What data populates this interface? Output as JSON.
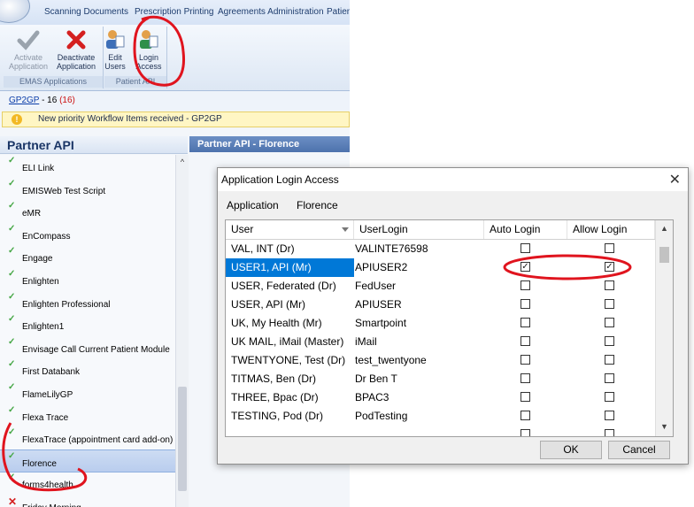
{
  "menubar": {
    "tabs": [
      "Scanning Documents",
      "Prescription Printing",
      "Agreements Administration",
      "Patien"
    ]
  },
  "ribbon": {
    "groups": [
      {
        "label": "EMAS Applications",
        "buttons": [
          {
            "label": "Activate Application",
            "icon": "check-icon",
            "enabled": false
          },
          {
            "label": "Deactivate Application",
            "icon": "red-x-icon",
            "enabled": true
          }
        ]
      },
      {
        "label": "Patient API",
        "buttons": [
          {
            "label": "Edit Users",
            "icon": "users-icon",
            "enabled": true
          },
          {
            "label": "Login Access",
            "icon": "user-key-icon",
            "enabled": true
          }
        ]
      }
    ]
  },
  "gp2gp": {
    "link": "GP2GP",
    "count": "- 16",
    "count_red": "(16)"
  },
  "notice": {
    "text": "New priority Workflow Items received - GP2GP",
    "icon": "warning-icon"
  },
  "partner_panel": {
    "title": "Partner API"
  },
  "detail_panel": {
    "title": "Partner API - Florence"
  },
  "app_list": [
    {
      "name": "ELI Link",
      "status": "tick"
    },
    {
      "name": "EMISWeb Test Script",
      "status": "tick"
    },
    {
      "name": "eMR",
      "status": "tick"
    },
    {
      "name": "EnCompass",
      "status": "tick"
    },
    {
      "name": "Engage",
      "status": "tick"
    },
    {
      "name": "Enlighten",
      "status": "tick"
    },
    {
      "name": "Enlighten Professional",
      "status": "tick"
    },
    {
      "name": "Enlighten1",
      "status": "tick"
    },
    {
      "name": "Envisage Call Current Patient Module",
      "status": "tick"
    },
    {
      "name": "First Databank",
      "status": "tick"
    },
    {
      "name": "FlameLilyGP",
      "status": "tick"
    },
    {
      "name": "Flexa Trace",
      "status": "tick"
    },
    {
      "name": "FlexaTrace (appointment card add-on)",
      "status": "tick"
    },
    {
      "name": "Florence",
      "status": "tick",
      "selected": true
    },
    {
      "name": "forms4health",
      "status": "tick"
    },
    {
      "name": "Friday Morning",
      "status": "cross"
    }
  ],
  "dialog": {
    "title": "Application Login Access",
    "close": "✕",
    "application_label": "Application",
    "application_value": "Florence",
    "columns": [
      "User",
      "UserLogin",
      "Auto Login",
      "Allow Login"
    ],
    "rows": [
      {
        "user": "VAL, INT (Dr)",
        "login": "VALINTE76598",
        "auto": false,
        "allow": false
      },
      {
        "user": "USER1, API (Mr)",
        "login": "APIUSER2",
        "auto": true,
        "allow": true,
        "selected": true
      },
      {
        "user": "USER, Federated (Dr)",
        "login": "FedUser",
        "auto": false,
        "allow": false
      },
      {
        "user": "USER, API (Mr)",
        "login": "APIUSER",
        "auto": false,
        "allow": false
      },
      {
        "user": "UK, My Health (Mr)",
        "login": "Smartpoint",
        "auto": false,
        "allow": false
      },
      {
        "user": "UK MAIL, iMail (Master)",
        "login": "iMail",
        "auto": false,
        "allow": false
      },
      {
        "user": "TWENTYONE, Test (Dr)",
        "login": "test_twentyone",
        "auto": false,
        "allow": false
      },
      {
        "user": "TITMAS, Ben (Dr)",
        "login": "Dr Ben T",
        "auto": false,
        "allow": false
      },
      {
        "user": "THREE, Bpac (Dr)",
        "login": "BPAC3",
        "auto": false,
        "allow": false
      },
      {
        "user": "TESTING, Pod (Dr)",
        "login": "PodTesting",
        "auto": false,
        "allow": false
      },
      {
        "user": "",
        "login": "",
        "auto": false,
        "allow": false
      }
    ],
    "ok": "OK",
    "cancel": "Cancel"
  },
  "colors": {
    "accent": "#0078d7",
    "annotation": "#e0141e",
    "tick": "#44a644",
    "cross": "#d42020"
  }
}
